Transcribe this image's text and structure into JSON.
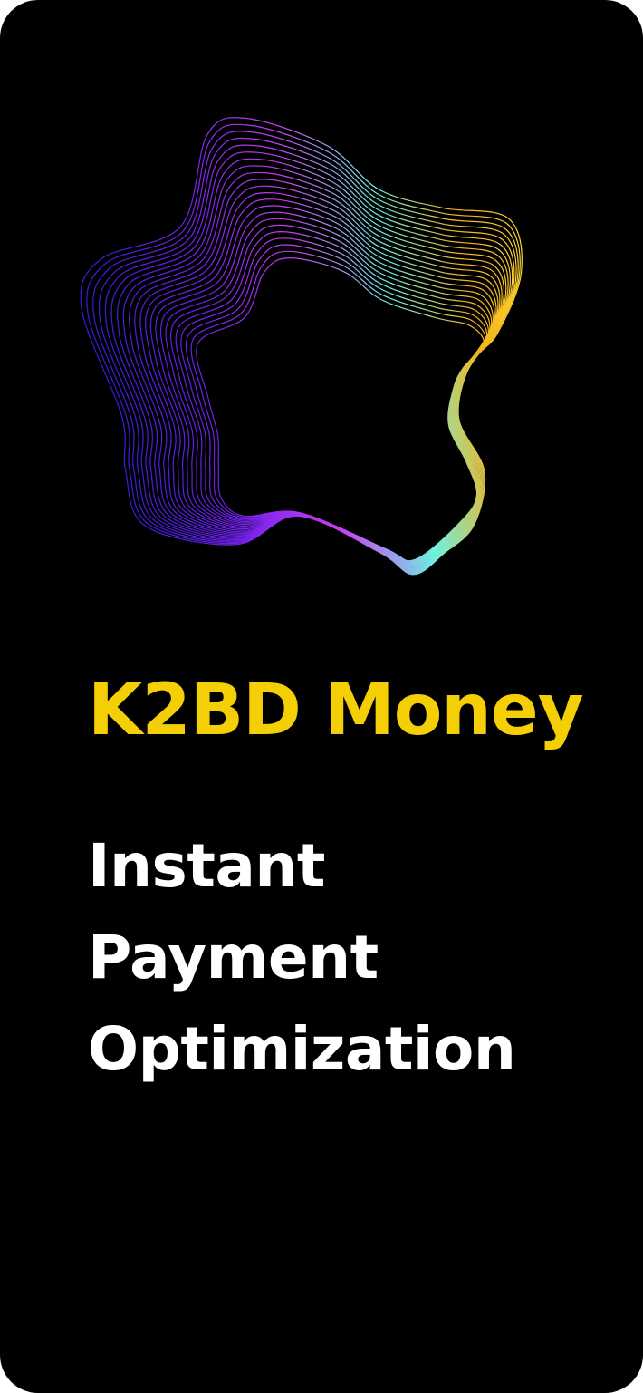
{
  "brand": {
    "title": "K2BD Money",
    "title_color": "#f5cf05"
  },
  "tagline": {
    "lines": [
      "Instant",
      "Payment",
      "Optimization"
    ],
    "color": "#ffffff"
  },
  "artwork": {
    "icon": "wave-ring-icon",
    "gradient_colors": [
      "#2d1bd6",
      "#7a22f0",
      "#c83cf2",
      "#6ff3e1",
      "#f6b21c",
      "#ffd633"
    ]
  },
  "background_color": "#000000"
}
